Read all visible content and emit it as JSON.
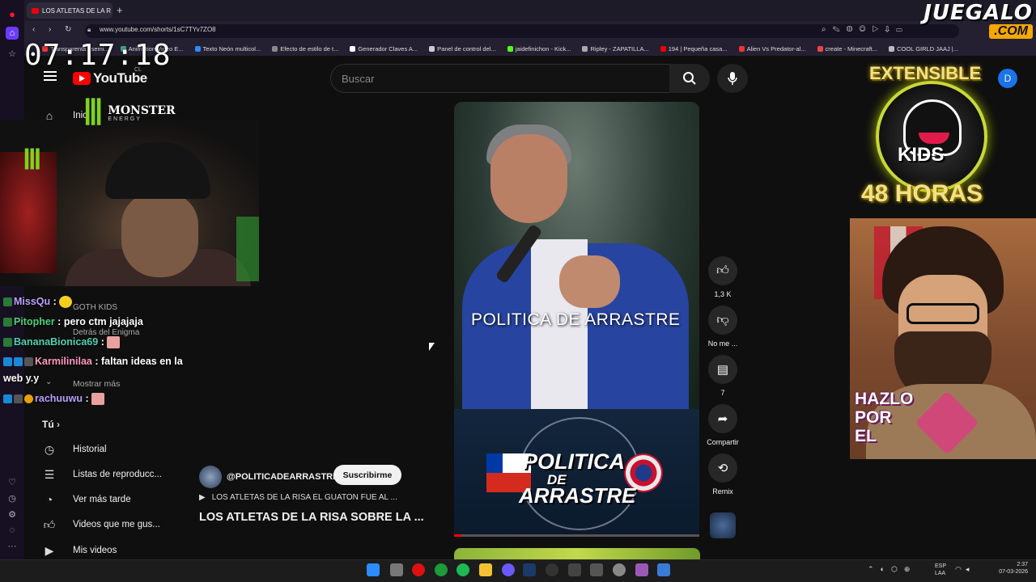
{
  "clock": "07:17:18",
  "overlay_logo": {
    "line1": "JUEGALO",
    "line2": ".COM"
  },
  "browser": {
    "tab_title": "LOS ATLETAS DE LA R",
    "url": "www.youtube.com/shorts/1sC7TYv7ZO8",
    "bookmarks": [
      "Transparenta / semi...",
      "Animation Video E...",
      "Texto Neón multicol...",
      "Efecto de estilo de t...",
      "Generador Claves A...",
      "Panel de control del...",
      "jaidefinichon - Kick...",
      "Ripley - ZAPATILLA...",
      "194 | Pequeña casa...",
      "Alien Vs Predator-al...",
      "create - Minecraft...",
      "COOL GIRLD JAAJ |..."
    ]
  },
  "youtube": {
    "logo": "YouTube",
    "country": "CL",
    "search_placeholder": "Buscar",
    "home_partial": "Inic",
    "sidebar": {
      "section": "Tú",
      "items": [
        "Historial",
        "Listas de reproducc...",
        "Ver más tarde",
        "Videos que me gus...",
        "Mis videos"
      ]
    },
    "ghost_sidebar": [
      "GOTH KIDS",
      "Detrás del Enigma",
      "Mostrar más"
    ]
  },
  "monster": {
    "brand": "MONSTER",
    "sub": "ENERGY"
  },
  "chat": [
    {
      "user": "MissQu",
      "text": ""
    },
    {
      "user": "Pitopher",
      "text": "pero ctm jajajaja"
    },
    {
      "user": "BananaBionica69",
      "text": ""
    },
    {
      "user": "Karmilinilaa",
      "text": "faltan ideas en la"
    },
    {
      "user": "",
      "text": "web y.y"
    },
    {
      "user": "rachuuwu",
      "text": ""
    }
  ],
  "short": {
    "overlay_text": "POLITICA DE ARRASTRE",
    "banner": {
      "line1": "POLITICA",
      "line2": "DE",
      "line3": "ARRASTRE"
    },
    "channel": "@POLITICADEARRASTRE",
    "subscribe": "Suscribirme",
    "song": "LOS ATLETAS DE LA RISA EL GUATON FUE AL ...",
    "title": "LOS ATLETAS DE LA RISA SOBRE LA ...",
    "progress": 0.03
  },
  "actions": {
    "like": "1,3 K",
    "dislike": "No me ...",
    "comments": "7",
    "share": "Compartir",
    "remix": "Remix"
  },
  "promo": {
    "extensible": "EXTENSIBLE",
    "kids": "KIDS",
    "hours": "48 HORAS",
    "avatar_letter": "D"
  },
  "art": {
    "line1": "HAZLO",
    "line2": "POR",
    "line3": "EL"
  },
  "tray": {
    "lang1": "ESP",
    "lang2": "LAA",
    "time": "2:37",
    "date": "07-03-2026"
  },
  "colors": {
    "yt_red": "#ff0000",
    "monster_green": "#7fd31d",
    "promo_gold": "#f2e08a"
  }
}
